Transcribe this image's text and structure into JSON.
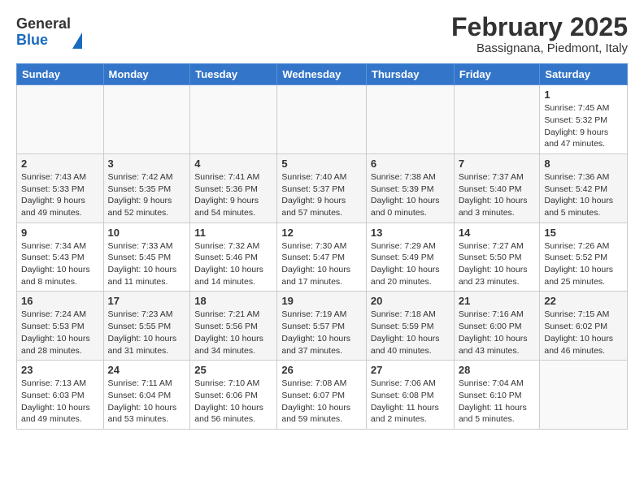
{
  "logo": {
    "general": "General",
    "blue": "Blue"
  },
  "title": "February 2025",
  "subtitle": "Bassignana, Piedmont, Italy",
  "days_of_week": [
    "Sunday",
    "Monday",
    "Tuesday",
    "Wednesday",
    "Thursday",
    "Friday",
    "Saturday"
  ],
  "weeks": [
    [
      {
        "day": "",
        "info": ""
      },
      {
        "day": "",
        "info": ""
      },
      {
        "day": "",
        "info": ""
      },
      {
        "day": "",
        "info": ""
      },
      {
        "day": "",
        "info": ""
      },
      {
        "day": "",
        "info": ""
      },
      {
        "day": "1",
        "info": "Sunrise: 7:45 AM\nSunset: 5:32 PM\nDaylight: 9 hours and 47 minutes."
      }
    ],
    [
      {
        "day": "2",
        "info": "Sunrise: 7:43 AM\nSunset: 5:33 PM\nDaylight: 9 hours and 49 minutes."
      },
      {
        "day": "3",
        "info": "Sunrise: 7:42 AM\nSunset: 5:35 PM\nDaylight: 9 hours and 52 minutes."
      },
      {
        "day": "4",
        "info": "Sunrise: 7:41 AM\nSunset: 5:36 PM\nDaylight: 9 hours and 54 minutes."
      },
      {
        "day": "5",
        "info": "Sunrise: 7:40 AM\nSunset: 5:37 PM\nDaylight: 9 hours and 57 minutes."
      },
      {
        "day": "6",
        "info": "Sunrise: 7:38 AM\nSunset: 5:39 PM\nDaylight: 10 hours and 0 minutes."
      },
      {
        "day": "7",
        "info": "Sunrise: 7:37 AM\nSunset: 5:40 PM\nDaylight: 10 hours and 3 minutes."
      },
      {
        "day": "8",
        "info": "Sunrise: 7:36 AM\nSunset: 5:42 PM\nDaylight: 10 hours and 5 minutes."
      }
    ],
    [
      {
        "day": "9",
        "info": "Sunrise: 7:34 AM\nSunset: 5:43 PM\nDaylight: 10 hours and 8 minutes."
      },
      {
        "day": "10",
        "info": "Sunrise: 7:33 AM\nSunset: 5:45 PM\nDaylight: 10 hours and 11 minutes."
      },
      {
        "day": "11",
        "info": "Sunrise: 7:32 AM\nSunset: 5:46 PM\nDaylight: 10 hours and 14 minutes."
      },
      {
        "day": "12",
        "info": "Sunrise: 7:30 AM\nSunset: 5:47 PM\nDaylight: 10 hours and 17 minutes."
      },
      {
        "day": "13",
        "info": "Sunrise: 7:29 AM\nSunset: 5:49 PM\nDaylight: 10 hours and 20 minutes."
      },
      {
        "day": "14",
        "info": "Sunrise: 7:27 AM\nSunset: 5:50 PM\nDaylight: 10 hours and 23 minutes."
      },
      {
        "day": "15",
        "info": "Sunrise: 7:26 AM\nSunset: 5:52 PM\nDaylight: 10 hours and 25 minutes."
      }
    ],
    [
      {
        "day": "16",
        "info": "Sunrise: 7:24 AM\nSunset: 5:53 PM\nDaylight: 10 hours and 28 minutes."
      },
      {
        "day": "17",
        "info": "Sunrise: 7:23 AM\nSunset: 5:55 PM\nDaylight: 10 hours and 31 minutes."
      },
      {
        "day": "18",
        "info": "Sunrise: 7:21 AM\nSunset: 5:56 PM\nDaylight: 10 hours and 34 minutes."
      },
      {
        "day": "19",
        "info": "Sunrise: 7:19 AM\nSunset: 5:57 PM\nDaylight: 10 hours and 37 minutes."
      },
      {
        "day": "20",
        "info": "Sunrise: 7:18 AM\nSunset: 5:59 PM\nDaylight: 10 hours and 40 minutes."
      },
      {
        "day": "21",
        "info": "Sunrise: 7:16 AM\nSunset: 6:00 PM\nDaylight: 10 hours and 43 minutes."
      },
      {
        "day": "22",
        "info": "Sunrise: 7:15 AM\nSunset: 6:02 PM\nDaylight: 10 hours and 46 minutes."
      }
    ],
    [
      {
        "day": "23",
        "info": "Sunrise: 7:13 AM\nSunset: 6:03 PM\nDaylight: 10 hours and 49 minutes."
      },
      {
        "day": "24",
        "info": "Sunrise: 7:11 AM\nSunset: 6:04 PM\nDaylight: 10 hours and 53 minutes."
      },
      {
        "day": "25",
        "info": "Sunrise: 7:10 AM\nSunset: 6:06 PM\nDaylight: 10 hours and 56 minutes."
      },
      {
        "day": "26",
        "info": "Sunrise: 7:08 AM\nSunset: 6:07 PM\nDaylight: 10 hours and 59 minutes."
      },
      {
        "day": "27",
        "info": "Sunrise: 7:06 AM\nSunset: 6:08 PM\nDaylight: 11 hours and 2 minutes."
      },
      {
        "day": "28",
        "info": "Sunrise: 7:04 AM\nSunset: 6:10 PM\nDaylight: 11 hours and 5 minutes."
      },
      {
        "day": "",
        "info": ""
      }
    ]
  ]
}
